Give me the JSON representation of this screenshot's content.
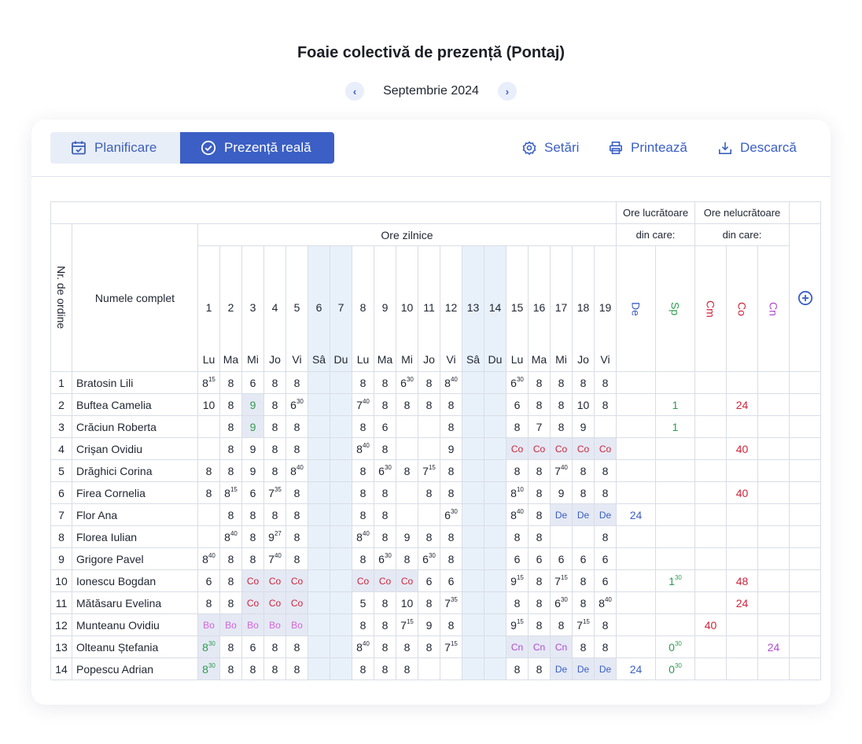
{
  "title": "Foaie colectivă de prezență (Pontaj)",
  "month_nav": {
    "label": "Septembrie 2024",
    "prev_icon": "‹",
    "next_icon": "›"
  },
  "toolbar": {
    "tab_planning": "Planificare",
    "tab_real": "Prezență reală",
    "settings": "Setări",
    "print": "Printează",
    "download": "Descarcă"
  },
  "colors": {
    "accent": "#3b5fc4",
    "co": "#d0243a",
    "sp": "#2e9b4e",
    "de": "#3b5fc4",
    "cn": "#b04ad0",
    "bo": "#d464d8"
  },
  "table": {
    "group_worked": "Ore lucrătoare",
    "group_nonworked": "Ore nelucrătoare",
    "of_which_1": "din care:",
    "of_which_2": "din care:",
    "daily_hours": "Ore zilnice",
    "col_nr": "Nr. de ordine",
    "col_name": "Numele complet",
    "days": [
      {
        "n": "1",
        "w": "Lu",
        "we": false
      },
      {
        "n": "2",
        "w": "Ma",
        "we": false
      },
      {
        "n": "3",
        "w": "Mi",
        "we": false
      },
      {
        "n": "4",
        "w": "Jo",
        "we": false
      },
      {
        "n": "5",
        "w": "Vi",
        "we": false
      },
      {
        "n": "6",
        "w": "Sâ",
        "we": true
      },
      {
        "n": "7",
        "w": "Du",
        "we": true
      },
      {
        "n": "8",
        "w": "Lu",
        "we": false
      },
      {
        "n": "9",
        "w": "Ma",
        "we": false
      },
      {
        "n": "10",
        "w": "Mi",
        "we": false
      },
      {
        "n": "11",
        "w": "Jo",
        "we": false
      },
      {
        "n": "12",
        "w": "Vi",
        "we": false
      },
      {
        "n": "13",
        "w": "Sâ",
        "we": true
      },
      {
        "n": "14",
        "w": "Du",
        "we": true
      },
      {
        "n": "15",
        "w": "Lu",
        "we": false
      },
      {
        "n": "16",
        "w": "Ma",
        "we": false
      },
      {
        "n": "17",
        "w": "Mi",
        "we": false
      },
      {
        "n": "18",
        "w": "Jo",
        "we": false
      },
      {
        "n": "19",
        "w": "Vi",
        "we": false
      }
    ],
    "sum_cols": [
      {
        "label": "De",
        "color": "#3b5fc4"
      },
      {
        "label": "Sp",
        "color": "#2e9b4e"
      },
      {
        "label": "Cm",
        "color": "#d0243a"
      },
      {
        "label": "Co",
        "color": "#d0243a"
      },
      {
        "label": "Cn",
        "color": "#b04ad0"
      }
    ],
    "rows": [
      {
        "nr": "1",
        "name": "Bratosin Lili",
        "days": [
          "8^15",
          "8",
          "6",
          "8",
          "8",
          "",
          "",
          "8",
          "8",
          "6^30",
          "8",
          "8^40",
          "",
          "",
          "6^30",
          "8",
          "8",
          "8",
          "8"
        ],
        "sums": [
          "",
          "",
          "",
          "",
          ""
        ]
      },
      {
        "nr": "2",
        "name": "Buftea Camelia",
        "days": [
          "10",
          "8",
          "9",
          "8",
          "6^30",
          "",
          "",
          "7^40",
          "8",
          "8",
          "8",
          "8",
          "",
          "",
          "6",
          "8",
          "8",
          "10",
          "8"
        ],
        "sums": [
          "",
          "1",
          "",
          "24",
          ""
        ]
      },
      {
        "nr": "3",
        "name": "Crăciun Roberta",
        "days": [
          "",
          "8",
          "9",
          "8",
          "8",
          "",
          "",
          "8",
          "6",
          "",
          "",
          "8",
          "",
          "",
          "8",
          "7",
          "8",
          "9",
          ""
        ],
        "sums": [
          "",
          "1",
          "",
          "",
          ""
        ]
      },
      {
        "nr": "4",
        "name": "Crișan Ovidiu",
        "days": [
          "",
          "8",
          "9",
          "8",
          "8",
          "",
          "",
          "8^40",
          "8",
          "",
          "",
          "9",
          "",
          "",
          "Co",
          "Co",
          "Co",
          "Co",
          "Co"
        ],
        "sums": [
          "",
          "",
          "",
          "40",
          ""
        ]
      },
      {
        "nr": "5",
        "name": "Drăghici Corina",
        "days": [
          "8",
          "8",
          "9",
          "8",
          "8^40",
          "",
          "",
          "8",
          "6^30",
          "8",
          "7^15",
          "8",
          "",
          "",
          "8",
          "8",
          "7^40",
          "8",
          "8"
        ],
        "sums": [
          "",
          "",
          "",
          "",
          ""
        ]
      },
      {
        "nr": "6",
        "name": "Firea Cornelia",
        "days": [
          "8",
          "8^15",
          "6",
          "7^35",
          "8",
          "",
          "",
          "8",
          "8",
          "",
          "8",
          "8",
          "",
          "",
          "8^10",
          "8",
          "9",
          "8",
          "8"
        ],
        "sums": [
          "",
          "",
          "",
          "40",
          ""
        ]
      },
      {
        "nr": "7",
        "name": "Flor Ana",
        "days": [
          "",
          "8",
          "8",
          "8",
          "8",
          "",
          "",
          "8",
          "8",
          "",
          "",
          "6^30",
          "",
          "",
          "8^40",
          "8",
          "De",
          "De",
          "De"
        ],
        "sums": [
          "24",
          "",
          "",
          "",
          ""
        ]
      },
      {
        "nr": "8",
        "name": "Florea Iulian",
        "days": [
          "",
          "8^40",
          "8",
          "9^27",
          "8",
          "",
          "",
          "8^40",
          "8",
          "9",
          "8",
          "8",
          "",
          "",
          "8",
          "8",
          "",
          "",
          "8"
        ],
        "sums": [
          "",
          "",
          "",
          "",
          ""
        ]
      },
      {
        "nr": "9",
        "name": "Grigore Pavel",
        "days": [
          "8^40",
          "8",
          "8",
          "7^40",
          "8",
          "",
          "",
          "8",
          "6^30",
          "8",
          "6^30",
          "8",
          "",
          "",
          "6",
          "6",
          "6",
          "6",
          "6"
        ],
        "sums": [
          "",
          "",
          "",
          "",
          ""
        ]
      },
      {
        "nr": "10",
        "name": "Ionescu Bogdan",
        "days": [
          "6",
          "8",
          "Co",
          "Co",
          "Co",
          "",
          "",
          "Co",
          "Co",
          "Co",
          "6",
          "6",
          "",
          "",
          "9^15",
          "8",
          "7^15",
          "8",
          "6"
        ],
        "sums": [
          "",
          "1^30",
          "",
          "48",
          ""
        ]
      },
      {
        "nr": "11",
        "name": "Mătăsaru Evelina",
        "days": [
          "8",
          "8",
          "Co",
          "Co",
          "Co",
          "",
          "",
          "5",
          "8",
          "10",
          "8",
          "7^35",
          "",
          "",
          "8",
          "8",
          "6^30",
          "8",
          "8^40"
        ],
        "sums": [
          "",
          "",
          "",
          "24",
          ""
        ]
      },
      {
        "nr": "12",
        "name": "Munteanu Ovidiu",
        "days": [
          "Bo",
          "Bo",
          "Bo",
          "Bo",
          "Bo",
          "",
          "",
          "8",
          "8",
          "7^15",
          "9",
          "8",
          "",
          "",
          "9^15",
          "8",
          "8",
          "7^15",
          "8"
        ],
        "sums": [
          "",
          "",
          "40",
          "",
          ""
        ]
      },
      {
        "nr": "13",
        "name": "Olteanu Ștefania",
        "days": [
          "8^30",
          "8",
          "6",
          "8",
          "8",
          "",
          "",
          "8^40",
          "8",
          "8",
          "8",
          "7^15",
          "",
          "",
          "Cn",
          "Cn",
          "Cn",
          "8",
          "8"
        ],
        "sums": [
          "",
          "0^30",
          "",
          "",
          "24"
        ]
      },
      {
        "nr": "14",
        "name": "Popescu Adrian",
        "days": [
          "8^30",
          "8",
          "8",
          "8",
          "8",
          "",
          "",
          "8",
          "8",
          "8",
          "",
          "",
          "",
          "",
          "8",
          "8",
          "De",
          "De",
          "De"
        ],
        "sums": [
          "24",
          "0^30",
          "",
          "",
          ""
        ]
      }
    ]
  }
}
